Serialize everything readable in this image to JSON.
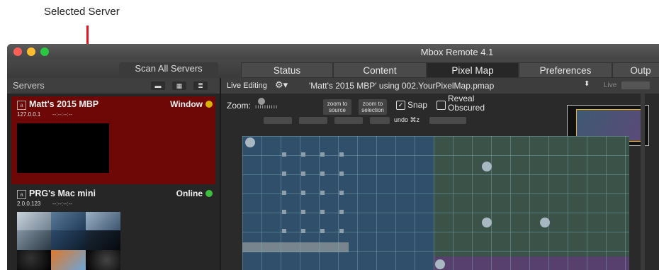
{
  "annotation": {
    "label": "Selected Server",
    "color": "#e1131c"
  },
  "window": {
    "title": "Mbox Remote 4.1"
  },
  "toolbar": {
    "scan_label": "Scan All Servers"
  },
  "tabs": [
    {
      "label": "Status",
      "active": false
    },
    {
      "label": "Content",
      "active": false
    },
    {
      "label": "Pixel Map",
      "active": true
    },
    {
      "label": "Preferences",
      "active": false
    },
    {
      "label": "Outp",
      "active": false
    }
  ],
  "servers_panel": {
    "title": "Servers",
    "view_icons": [
      "list-view-icon",
      "grid-view-icon",
      "detail-view-icon"
    ],
    "servers": [
      {
        "icon_letter": "a",
        "name": "Matt's 2015 MBP",
        "status": "Window",
        "status_color": "#d9b400",
        "ip": "127.0.0.1",
        "time": "--:--:--:--",
        "selected": true
      },
      {
        "icon_letter": "a",
        "name": "PRG's Mac mini",
        "status": "Online",
        "status_color": "#3fbf3f",
        "ip": "2.0.0.123",
        "time": "--:--:--:--",
        "selected": false
      }
    ]
  },
  "live_bar": {
    "label": "Live Editing",
    "gear_icon": "gear-icon",
    "map_selection": "'Matt's 2015 MBP' using 002.YourPixelMap.pmap",
    "live_label": "Live"
  },
  "zoom_controls": {
    "zoom_label": "Zoom:",
    "zoom_to_source": "zoom to source",
    "zoom_to_selection": "zoom to selection",
    "snap_label": "Snap",
    "snap_checked": true,
    "reveal_label": "Reveal Obscured",
    "reveal_checked": false,
    "undo_label": "undo ⌘z"
  }
}
